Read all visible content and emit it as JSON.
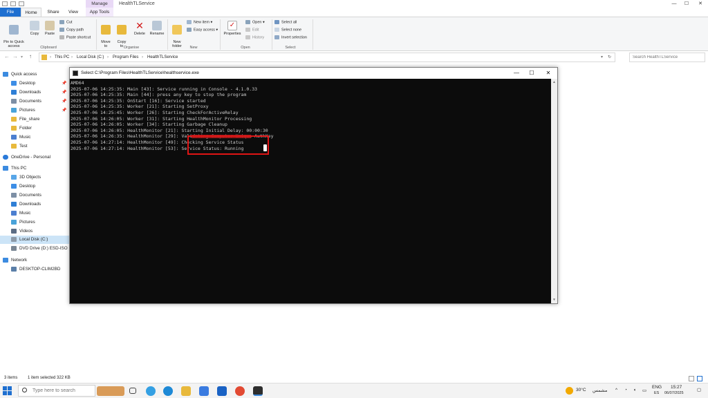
{
  "window": {
    "title": "HealthTLService",
    "manage_tab": "Manage",
    "controls": {
      "minimize": "—",
      "maximize": "☐",
      "close": "✕"
    }
  },
  "ribbon_tabs": [
    "File",
    "Home",
    "Share",
    "View",
    "App Tools"
  ],
  "ribbon": {
    "clipboard": {
      "pin": "Pin to Quick\naccess",
      "copy": "Copy",
      "paste": "Paste",
      "cut": "Cut",
      "copy_path": "Copy path",
      "paste_shortcut": "Paste shortcut",
      "label": "Clipboard"
    },
    "organise": {
      "move_to": "Move\nto",
      "copy_to": "Copy\nto",
      "delete": "Delete",
      "rename": "Rename",
      "label": "Organise"
    },
    "new": {
      "new_folder": "New\nfolder",
      "new_item": "New item",
      "easy_access": "Easy access",
      "label": "New"
    },
    "open": {
      "properties": "Properties",
      "open": "Open",
      "edit": "Edit",
      "history": "History",
      "label": "Open"
    },
    "select": {
      "select_all": "Select all",
      "select_none": "Select none",
      "invert_selection": "Invert selection",
      "label": "Select"
    }
  },
  "address": {
    "path": [
      "This PC",
      "Local Disk (C:)",
      "Program Files",
      "HealthTLService"
    ],
    "search_placeholder": "Search HealthTLService"
  },
  "nav": {
    "quick_access": "Quick access",
    "quick_items": [
      "Desktop",
      "Downloads",
      "Documents",
      "Pictures",
      "File_share",
      "Folder",
      "Music",
      "Test"
    ],
    "onedrive": "OneDrive - Personal",
    "this_pc": "This PC",
    "pc_items": [
      "3D Objects",
      "Desktop",
      "Documents",
      "Downloads",
      "Music",
      "Pictures",
      "Videos",
      "Local Disk (C:)",
      "DVD Drive (D:) ESD-ISO"
    ],
    "network": "Network",
    "network_items": [
      "DESKTOP-CLIM2BD"
    ]
  },
  "console": {
    "title": "Select C:\\Program Files\\HealthTLService\\healthservice.exe",
    "lines": [
      "AMD64",
      "2025-07-06 14:25:35: Main [43]: Service running in Console - 4.1.0.33",
      "2025-07-06 14:25:35: Main [44]: press any key to stop the program",
      "2025-07-06 14:25:35: OnStart [16]: Service started",
      "2025-07-06 14:25:35: Worker [21]: Starting SetProxy",
      "2025-07-06 14:25:45: Worker [26]: Starting CheckForActiveRelay",
      "2025-07-06 14:26:05: Worker [31]: Starting HealthMonitor Processing",
      "2025-07-06 14:26:05: Worker [34]: Starting Garbage Cleanup",
      "2025-07-06 14:26:05: HealthMonitor [21]: Starting Initial Delay: 00:00:30",
      "2025-07-06 14:26:35: HealthMonitor [29]: Validating Computer Unique AuthKey",
      "2025-07-06 14:27:14: HealthMonitor [49]: Checking Service Status",
      "2025-07-06 14:27:14: HealthMonitor [53]: Service Status: Running"
    ]
  },
  "statusbar": {
    "items": "3 items",
    "selected": "1 item selected  322 KB"
  },
  "taskbar": {
    "search": "Type here to search",
    "weather": "30°C",
    "weather_text": "مشمس",
    "lang": "ENG",
    "lang_sub": "ES",
    "time": "15:27",
    "date": "06/07/2025"
  }
}
